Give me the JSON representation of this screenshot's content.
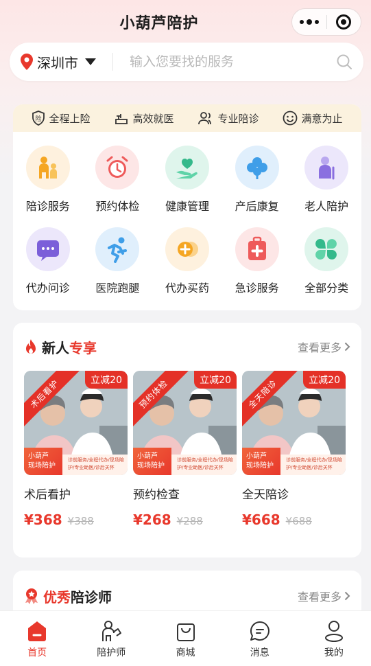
{
  "header": {
    "title": "小葫芦陪护",
    "more_icon": "more-dots-icon",
    "close_icon": "target-close-icon"
  },
  "search": {
    "city": "深圳市",
    "placeholder": "输入您要找的服务"
  },
  "features": [
    {
      "icon": "shield-icon",
      "label": "全程上险"
    },
    {
      "icon": "hospital-bed-icon",
      "label": "高效就医"
    },
    {
      "icon": "users-icon",
      "label": "专业陪诊"
    },
    {
      "icon": "smile-icon",
      "label": "满意为止"
    }
  ],
  "categories": [
    {
      "label": "陪诊服务",
      "icon": "family-icon",
      "color": "#f5a623"
    },
    {
      "label": "预约体检",
      "icon": "alarm-clock-icon",
      "color": "#ee5a5a"
    },
    {
      "label": "健康管理",
      "icon": "hand-heart-icon",
      "color": "#34b98b"
    },
    {
      "label": "产后康复",
      "icon": "clover-icon",
      "color": "#3f9ee8"
    },
    {
      "label": "老人陪护",
      "icon": "elderly-icon",
      "color": "#8a6fe0"
    },
    {
      "label": "代办问诊",
      "icon": "chat-bubble-icon",
      "color": "#7b5fd9"
    },
    {
      "label": "医院跑腿",
      "icon": "runner-icon",
      "color": "#3f9ee8"
    },
    {
      "label": "代办买药",
      "icon": "pill-icon",
      "color": "#f5a623"
    },
    {
      "label": "急诊服务",
      "icon": "medical-kit-icon",
      "color": "#ee5a5a"
    },
    {
      "label": "全部分类",
      "icon": "grid-clover-icon",
      "color": "#34b98b"
    }
  ],
  "newbie": {
    "title_main": "新人",
    "title_highlight": "专享",
    "more": "查看更多",
    "products": [
      {
        "tag": "术后看护",
        "discount": "立减20",
        "brand": "小葫芦\n现场陪护",
        "desc": "诊前服务/全程代办/现场陪护/专业助医/诊后关怀",
        "name": "术后看护",
        "price": "¥368",
        "old_price": "¥388"
      },
      {
        "tag": "预约体检",
        "discount": "立减20",
        "brand": "小葫芦\n现场陪护",
        "desc": "诊前服务/全程代办/现场陪护/专业助医/诊后关怀",
        "name": "预约检查",
        "price": "¥268",
        "old_price": "¥288"
      },
      {
        "tag": "全天陪诊",
        "discount": "立减20",
        "brand": "小葫芦\n现场陪护",
        "desc": "诊前服务/全程代办/现场陪护/专业助医/诊后关怀",
        "name": "全天陪诊",
        "price": "¥668",
        "old_price": "¥688"
      }
    ]
  },
  "escorts": {
    "title_highlight": "优秀",
    "title_main": "陪诊师",
    "more": "查看更多"
  },
  "tabbar": [
    {
      "label": "首页",
      "icon": "home-icon",
      "active": true
    },
    {
      "label": "陪护师",
      "icon": "caregiver-icon",
      "active": false
    },
    {
      "label": "商城",
      "icon": "shopping-bag-icon",
      "active": false
    },
    {
      "label": "消息",
      "icon": "message-icon",
      "active": false
    },
    {
      "label": "我的",
      "icon": "profile-icon",
      "active": false
    }
  ],
  "colors": {
    "accent": "#e8382c",
    "strip": "#fbf2df"
  }
}
